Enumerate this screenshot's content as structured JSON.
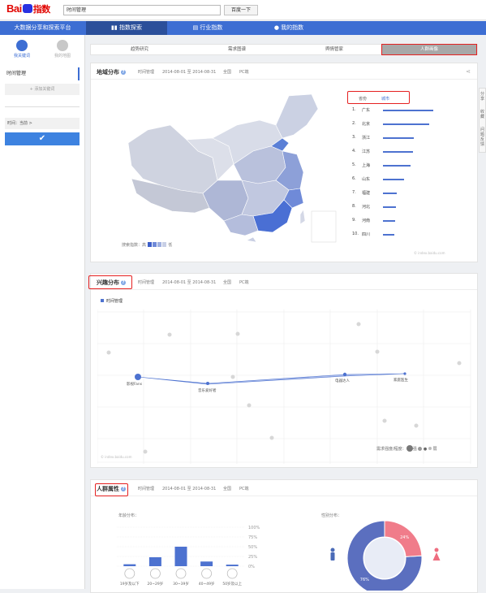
{
  "header": {
    "search_value": "时间管理",
    "search_button": "百度一下"
  },
  "nav": {
    "platform": "大数据分享和探索平台",
    "items": [
      "指数探索",
      "行业指数",
      "我的指数"
    ]
  },
  "sidebar": {
    "tabs": [
      "我关键词",
      "我的地图"
    ],
    "keyword": "时间管理",
    "add_keyword": "+ 添加关键词",
    "time_label": "时间：当前 >",
    "confirm": "✔"
  },
  "right_bar": {
    "items": [
      "分享",
      "收藏",
      "问题反馈"
    ]
  },
  "subtabs": [
    "趋势研究",
    "需求图谱",
    "舆情管家",
    "人群画像"
  ],
  "region": {
    "title": "地域分布",
    "keyword": "时间管理",
    "date_range": "2014-08-01 至 2014-08-31",
    "scope": "全国",
    "device": "PC端",
    "toggle": [
      "省份",
      "城市"
    ],
    "legend_label_high": "搜索指数：高",
    "legend_label_low": "低",
    "watermark": "© index.baidu.com",
    "ranking": [
      {
        "rank": "1.",
        "name": "广东",
        "value": 100
      },
      {
        "rank": "2.",
        "name": "北京",
        "value": 92
      },
      {
        "rank": "3.",
        "name": "浙江",
        "value": 62
      },
      {
        "rank": "4.",
        "name": "江苏",
        "value": 60
      },
      {
        "rank": "5.",
        "name": "上海",
        "value": 55
      },
      {
        "rank": "6.",
        "name": "山东",
        "value": 42
      },
      {
        "rank": "7.",
        "name": "福建",
        "value": 28
      },
      {
        "rank": "8.",
        "name": "河北",
        "value": 26
      },
      {
        "rank": "9.",
        "name": "河南",
        "value": 24
      },
      {
        "rank": "10.",
        "name": "四川",
        "value": 22
      }
    ]
  },
  "interest": {
    "title": "兴趣分布",
    "keyword": "时间管理",
    "date_range": "2014-08-01 至 2014-08-31",
    "scope": "全国",
    "device": "PC端",
    "legend_keyword": "时间管理",
    "watermark": "© index.baidu.com",
    "strength_label": "需求强度/程度：",
    "strength_strong": "强",
    "strength_weak": "弱",
    "nodes": [
      "影视Fans",
      "音乐爱好者",
      "电器达人",
      "家庭医生"
    ]
  },
  "population": {
    "title": "人群属性",
    "keyword": "时间管理",
    "date_range": "2014-08-01 至 2014-08-31",
    "scope": "全国",
    "device": "PC端",
    "age_title": "年龄分布：",
    "gender_title": "性别分布：",
    "age_ticks": [
      "100%",
      "75%",
      "50%",
      "25%",
      "0%"
    ],
    "gender_male_label": "76%",
    "gender_female_label": "24%",
    "age_labels": [
      "19岁及以下",
      "20~29岁",
      "30~39岁",
      "40~49岁",
      "50岁及以上"
    ]
  },
  "chart_data": [
    {
      "type": "bar",
      "title": "年龄分布：",
      "categories": [
        "19岁及以下",
        "20~29岁",
        "30~39岁",
        "40~49岁",
        "50岁及以上"
      ],
      "values": [
        5,
        23,
        50,
        12,
        4
      ],
      "ylim": [
        0,
        100
      ]
    },
    {
      "type": "pie",
      "title": "性别分布：",
      "categories": [
        "男",
        "女"
      ],
      "values": [
        76,
        24
      ]
    }
  ],
  "colors": {
    "nav": "#3d6ed3",
    "highlight": "#e52020",
    "bar": "#4d72d0",
    "male": "#5b6fbf",
    "female": "#f07c8a"
  }
}
